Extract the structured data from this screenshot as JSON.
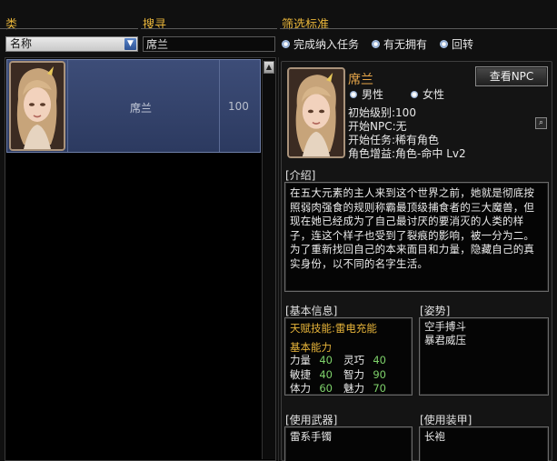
{
  "filter": {
    "category_label": "类",
    "search_label": "搜寻",
    "criteria_label": "筛选标准",
    "category_value": "名称",
    "search_value": "席兰",
    "options": [
      "完成纳入任务",
      "有无拥有",
      "回转"
    ]
  },
  "list": {
    "rows": [
      {
        "name": "席兰",
        "level": "100"
      }
    ]
  },
  "detail": {
    "name": "席兰",
    "view_npc_button": "查看NPC",
    "gender_options": [
      "男性",
      "女性"
    ],
    "initial_level": "初始级别:100",
    "start_npc": "开始NPC:无",
    "start_task": "开始任务:稀有角色",
    "role_bonus": "角色增益:角色-命中 Lv2",
    "intro_title": "[介绍]",
    "intro_text": "在五大元素的主人来到这个世界之前，她就是彻底按照弱肉强食的规则称霸最顶级捕食者的三大魔兽，但现在她已经成为了自己最讨厌的要消灭的人类的样子，连这个样子也受到了裂痕的影响，被一分为二。为了重新找回自己的本来面目和力量，隐藏自己的真实身份，以不同的名字生活。",
    "basic_title": "[基本信息]",
    "talent": "天赋技能:雷电充能",
    "basic_ability": "基本能力",
    "stats": [
      {
        "k1": "力量",
        "v1": "40",
        "k2": "灵巧",
        "v2": "40"
      },
      {
        "k1": "敏捷",
        "v1": "40",
        "k2": "智力",
        "v2": "90"
      },
      {
        "k1": "体力",
        "v1": "60",
        "k2": "魅力",
        "v2": "70"
      }
    ],
    "stance_title": "[姿势]",
    "stances": [
      "空手搏斗",
      "暴君威压"
    ],
    "weapon_title": "[使用武器]",
    "weapon": "雷系手镯",
    "armor_title": "[使用装甲]",
    "armor": "长袍"
  },
  "colors": {
    "gold": "#e8b53a",
    "name_orange": "#e8a74a",
    "stat_green": "#7ed16a",
    "selected_row": "#3d4d78"
  },
  "icons": [
    "dropdown-arrow-icon",
    "radio-icon",
    "scroll-up-icon",
    "magnifier-icon"
  ]
}
